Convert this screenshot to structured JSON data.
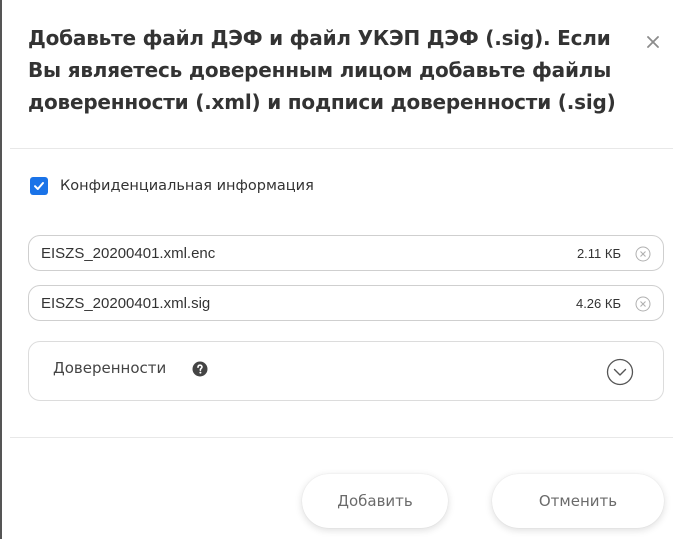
{
  "dialog": {
    "title": "Добавьте файл ДЭФ и файл УКЭП ДЭФ (.sig). Если Вы являетесь доверенным лицом добавьте файлы доверенности (.xml) и подписи доверенности (.sig)",
    "close_icon": "close-icon"
  },
  "confidential": {
    "label": "Конфиденциальная информация",
    "checked": true
  },
  "files": [
    {
      "name": "EISZS_20200401.xml.enc",
      "size": "2.11 КБ"
    },
    {
      "name": "EISZS_20200401.xml.sig",
      "size": "4.26 КБ"
    }
  ],
  "power_of_attorney": {
    "label": "Доверенности",
    "help_icon": "question-circle-icon",
    "expand_icon": "chevron-down-circle-icon"
  },
  "buttons": {
    "add_label": "Добавить",
    "cancel_label": "Отменить"
  },
  "colors": {
    "checkbox": "#1a73e8",
    "text": "#333333"
  }
}
